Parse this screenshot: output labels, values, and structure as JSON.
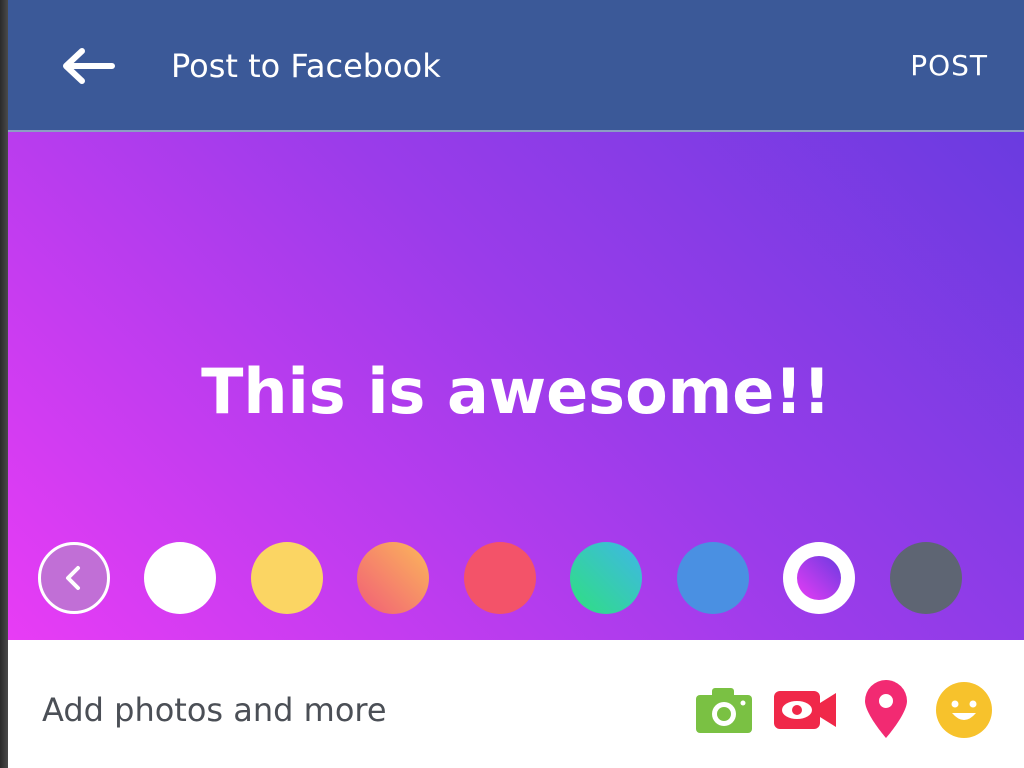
{
  "header": {
    "title": "Post to Facebook",
    "post_label": "POST",
    "back_icon": "arrow-left-icon",
    "background_color": "#3b5998"
  },
  "composer": {
    "text": "This is awesome!!",
    "gradient_colors": [
      "#e83cf5",
      "#9b3cea",
      "#6a3be0"
    ],
    "background_options": [
      {
        "name": "collapse",
        "icon": "chevron-left-icon"
      },
      {
        "name": "white",
        "color": "#ffffff"
      },
      {
        "name": "yellow",
        "color": "#fbd563"
      },
      {
        "name": "orange-gradient",
        "colors": [
          "#fbb85a",
          "#f15d77"
        ]
      },
      {
        "name": "red",
        "color": "#f35369"
      },
      {
        "name": "teal-gradient",
        "colors": [
          "#2fe07f",
          "#3fb6e8"
        ]
      },
      {
        "name": "blue",
        "color": "#4a90e2"
      },
      {
        "name": "purple-gradient",
        "selected": true,
        "colors": [
          "#e83cf5",
          "#6a3be0"
        ]
      },
      {
        "name": "gray",
        "color": "#5e6573"
      }
    ]
  },
  "bottom_bar": {
    "label": "Add photos and more",
    "tools": [
      {
        "name": "camera-icon",
        "color": "#7ac143"
      },
      {
        "name": "live-video-icon",
        "color": "#f02849"
      },
      {
        "name": "location-pin-icon",
        "color": "#f22a72"
      },
      {
        "name": "feeling-smile-icon",
        "color": "#f7c22c"
      }
    ]
  }
}
